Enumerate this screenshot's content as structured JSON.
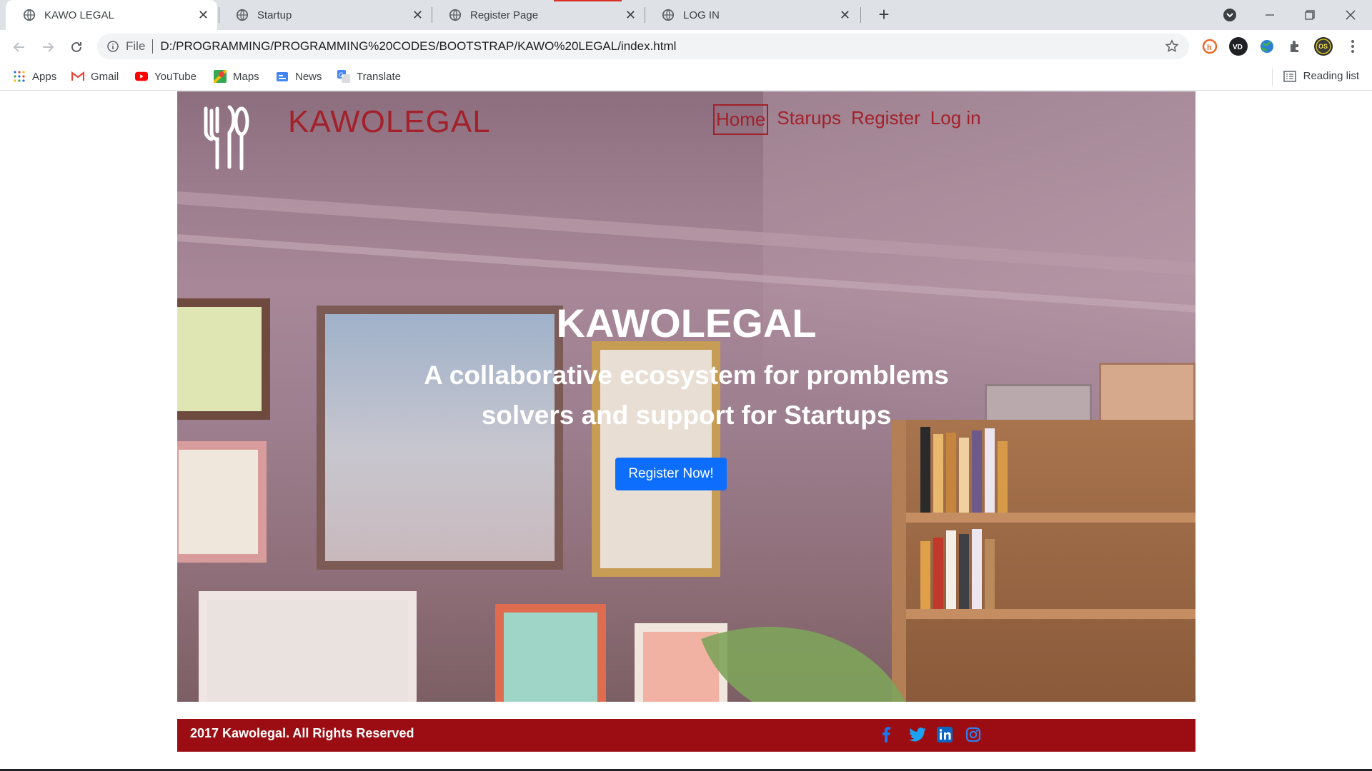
{
  "browser": {
    "tabs": [
      {
        "title": "KAWO LEGAL",
        "active": true
      },
      {
        "title": "Startup",
        "active": false
      },
      {
        "title": "Register Page",
        "active": false
      },
      {
        "title": "LOG IN",
        "active": false
      }
    ],
    "address": {
      "scheme_label": "File",
      "url": "D:/PROGRAMMING/PROGRAMMING%20CODES/BOOTSTRAP/KAWO%20LEGAL/index.html"
    },
    "bookmarks": [
      "Apps",
      "Gmail",
      "YouTube",
      "Maps",
      "News",
      "Translate"
    ],
    "reading_list": "Reading list"
  },
  "site": {
    "brand": "KAWOLEGAL",
    "nav": [
      "Home",
      "Starups",
      "Register",
      "Log in"
    ],
    "active_nav": "Home",
    "hero": {
      "title": "KAWOLEGAL",
      "subtitle": "A collaborative ecosystem for promblems solvers and support for Startups",
      "cta": "Register Now!"
    },
    "footer": {
      "copyright": "2017 Kawolegal. All Rights Reserved",
      "social": [
        "facebook-icon",
        "twitter-icon",
        "linkedin-icon",
        "instagram-icon"
      ]
    }
  },
  "colors": {
    "brand_red": "#a3212b",
    "footer_red": "#9b0d12",
    "cta_blue": "#0d6efd"
  }
}
